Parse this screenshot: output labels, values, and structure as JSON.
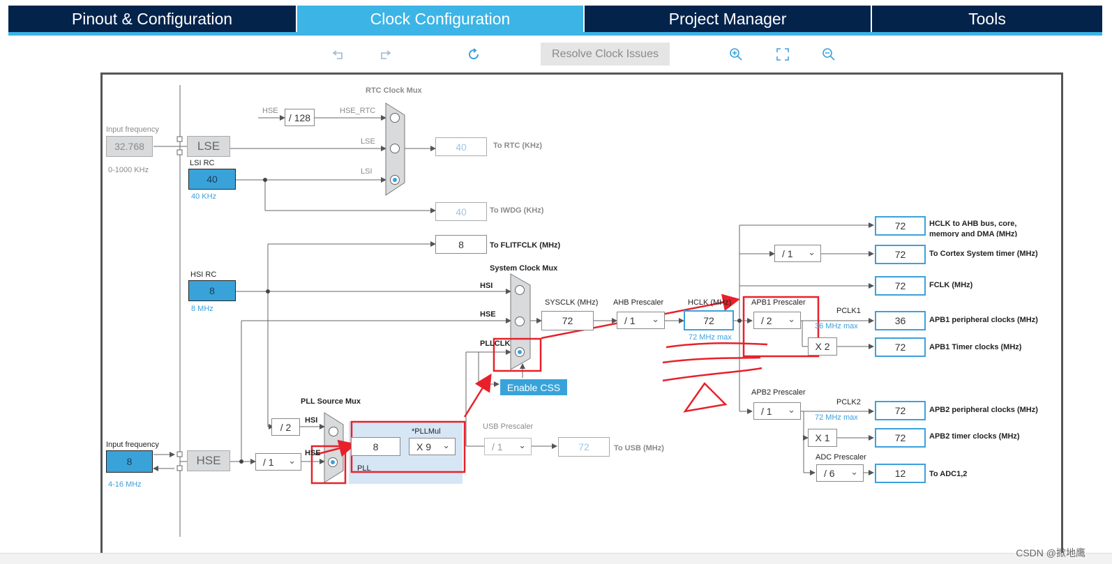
{
  "tabs": [
    {
      "label": "Pinout & Configuration",
      "active": false
    },
    {
      "label": "Clock Configuration",
      "active": true
    },
    {
      "label": "Project Manager",
      "active": false
    },
    {
      "label": "Tools",
      "active": false
    }
  ],
  "toolbar": {
    "undo_icon": "undo-icon",
    "redo_icon": "redo-icon",
    "refresh_icon": "refresh-icon",
    "resolve_label": "Resolve Clock Issues",
    "zoom_in_icon": "zoom-in-icon",
    "fit_icon": "fit-screen-icon",
    "zoom_out_icon": "zoom-out-icon"
  },
  "lse": {
    "input_label": "Input frequency",
    "input_value": "32.768",
    "range": "0-1000 KHz",
    "name": "LSE"
  },
  "lsi": {
    "title": "LSI RC",
    "value": "40",
    "unit": "40 KHz"
  },
  "rtc": {
    "mux_title": "RTC Clock Mux",
    "hse_label": "HSE",
    "div_value": "/ 128",
    "hse_rtc_label": "HSE_RTC",
    "lse_label": "LSE",
    "lsi_label": "LSI",
    "out_value": "40",
    "out_label": "To RTC (KHz)"
  },
  "iwdg": {
    "value": "40",
    "label": "To IWDG (KHz)"
  },
  "flit": {
    "value": "8",
    "label": "To FLITFCLK (MHz)"
  },
  "hsi": {
    "title": "HSI RC",
    "value": "8",
    "unit": "8 MHz"
  },
  "sysmux": {
    "title": "System Clock Mux",
    "hsi_label": "HSI",
    "hse_label": "HSE",
    "pll_label": "PLLCLK"
  },
  "enable_css": "Enable CSS",
  "sysclk": {
    "label": "SYSCLK (MHz)",
    "value": "72"
  },
  "ahb": {
    "label": "AHB Prescaler",
    "value": "/ 1"
  },
  "hclk": {
    "label": "HCLK (MHz)",
    "value": "72",
    "max": "72 MHz max"
  },
  "apb1": {
    "label": "APB1 Prescaler",
    "value": "/ 2",
    "pclk": "PCLK1",
    "max": "36 MHz max",
    "timer_mult": "X 2"
  },
  "apb2": {
    "label": "APB2 Prescaler",
    "value": "/ 1",
    "pclk": "PCLK2",
    "max": "72 MHz max",
    "timer_mult": "X 1"
  },
  "adc": {
    "label": "ADC Prescaler",
    "value": "/ 6"
  },
  "cortex_div": "/ 1",
  "outputs": [
    {
      "value": "72",
      "label": "HCLK to AHB bus, core,",
      "label2": "memory and DMA (MHz)"
    },
    {
      "value": "72",
      "label": "To Cortex System timer (MHz)"
    },
    {
      "value": "72",
      "label": "FCLK (MHz)"
    },
    {
      "value": "36",
      "label": "APB1 peripheral clocks (MHz)"
    },
    {
      "value": "72",
      "label": "APB1 Timer clocks (MHz)"
    },
    {
      "value": "72",
      "label": "APB2 peripheral clocks (MHz)"
    },
    {
      "value": "72",
      "label": "APB2 timer clocks (MHz)"
    },
    {
      "value": "12",
      "label": "To ADC1,2"
    }
  ],
  "pll": {
    "src_title": "PLL Source Mux",
    "hsi_div": "/ 2",
    "hsi_label": "HSI",
    "hse_label": "HSE",
    "input_value": "8",
    "mul_label": "*PLLMul",
    "mul_value": "X 9",
    "panel_label": "PLL"
  },
  "usb": {
    "label": "USB Prescaler",
    "value": "/ 1",
    "out_value": "72",
    "out_label": "To USB (MHz)"
  },
  "hse": {
    "input_label": "Input frequency",
    "input_value": "8",
    "range": "4-16 MHz",
    "name": "HSE",
    "div_value": "/ 1"
  },
  "watermark": "CSDN @掀地鹰",
  "colors": {
    "tab_bg": "#03234b",
    "accent": "#3cb4e6",
    "annotation": "#e8202a"
  }
}
